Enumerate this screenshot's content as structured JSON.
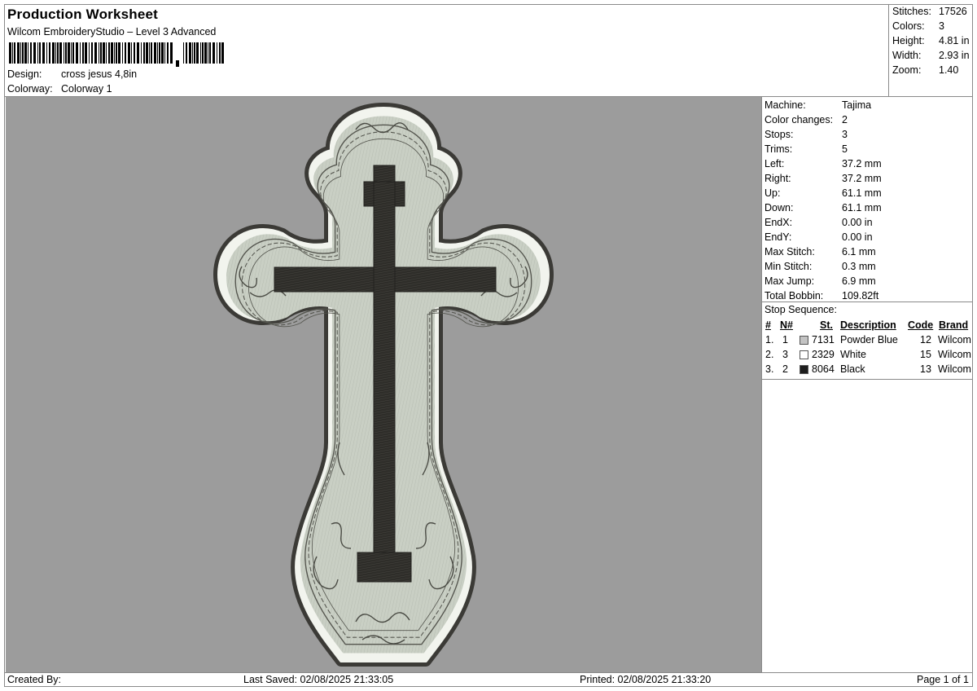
{
  "header": {
    "title": "Production Worksheet",
    "subtitle": "Wilcom EmbroideryStudio – Level 3 Advanced",
    "design_label": "Design:",
    "design_value": "cross jesus 4,8in",
    "colorway_label": "Colorway:",
    "colorway_value": "Colorway 1"
  },
  "stats": [
    {
      "label": "Stitches:",
      "value": "17526"
    },
    {
      "label": "Colors:",
      "value": "3"
    },
    {
      "label": "Height:",
      "value": "4.81 in"
    },
    {
      "label": "Width:",
      "value": "2.93 in"
    },
    {
      "label": "Zoom:",
      "value": "1.40"
    }
  ],
  "machine_info": [
    {
      "label": "Machine:",
      "value": "Tajima"
    },
    {
      "label": "Color changes:",
      "value": "2"
    },
    {
      "label": "Stops:",
      "value": "3"
    },
    {
      "label": "Trims:",
      "value": "5"
    },
    {
      "label": "Left:",
      "value": "37.2 mm"
    },
    {
      "label": "Right:",
      "value": "37.2 mm"
    },
    {
      "label": "Up:",
      "value": "61.1 mm"
    },
    {
      "label": "Down:",
      "value": "61.1 mm"
    },
    {
      "label": "EndX:",
      "value": "0.00 in"
    },
    {
      "label": "EndY:",
      "value": "0.00 in"
    },
    {
      "label": "Max Stitch:",
      "value": "6.1 mm"
    },
    {
      "label": "Min Stitch:",
      "value": "0.3 mm"
    },
    {
      "label": "Max Jump:",
      "value": "6.9 mm"
    },
    {
      "label": "Total Bobbin:",
      "value": "109.82ft"
    }
  ],
  "stop_sequence": {
    "title": "Stop Sequence:",
    "headers": {
      "num": "#",
      "n": "N#",
      "st": "St.",
      "description": "Description",
      "code": "Code",
      "brand": "Brand"
    },
    "rows": [
      {
        "num": "1.",
        "n": "1",
        "color": "#c3c3c3",
        "st": "7131",
        "description": "Powder Blue",
        "code": "12",
        "brand": "Wilcom"
      },
      {
        "num": "2.",
        "n": "3",
        "color": "#ffffff",
        "st": "2329",
        "description": "White",
        "code": "15",
        "brand": "Wilcom"
      },
      {
        "num": "3.",
        "n": "2",
        "color": "#1e1e1e",
        "st": "8064",
        "description": "Black",
        "code": "13",
        "brand": "Wilcom"
      }
    ]
  },
  "footer": {
    "created_by": "Created By:",
    "last_saved": "Last Saved: 02/08/2025 21:33:05",
    "printed": "Printed: 02/08/2025 21:33:20",
    "page": "Page 1 of 1"
  },
  "design_colors": {
    "background": "#9c9c9c",
    "outline": "#3b3a36",
    "white_border": "#f2f4ee",
    "fill": "#c9cfc4",
    "cross": "#2e2d29"
  }
}
